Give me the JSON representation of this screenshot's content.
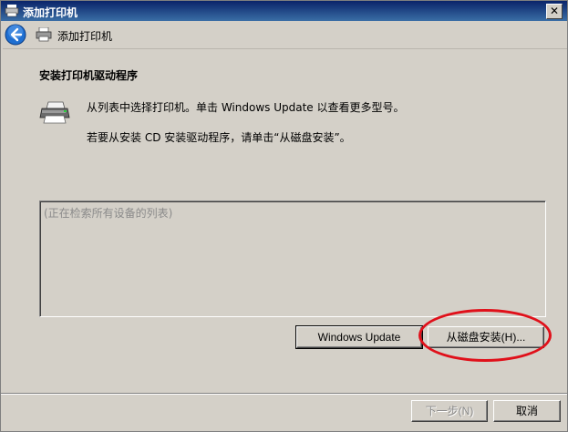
{
  "window": {
    "title": "添加打印机",
    "close_glyph": "✕"
  },
  "nav": {
    "back_icon": "back-arrow-icon",
    "title": "添加打印机"
  },
  "main": {
    "heading": "安装打印机驱动程序",
    "line1": "从列表中选择打印机。单击 Windows Update 以查看更多型号。",
    "line2": "若要从安装 CD 安装驱动程序，请单击“从磁盘安装”。",
    "list_placeholder": "(正在检索所有设备的列表)"
  },
  "buttons": {
    "windows_update": "Windows Update",
    "from_disk": "从磁盘安装(H)...",
    "next": "下一步(N)",
    "cancel": "取消"
  },
  "colors": {
    "annotation": "#e0101a",
    "title_bar": "#0a246a",
    "back_button": "#1f6fd1"
  }
}
